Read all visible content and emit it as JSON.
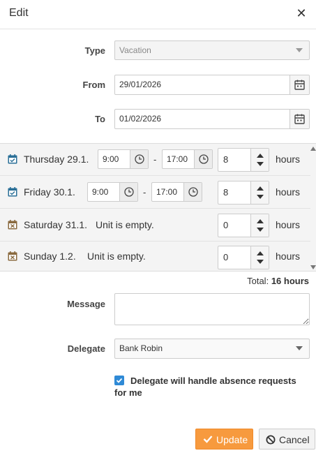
{
  "dialog": {
    "title": "Edit"
  },
  "form": {
    "type": {
      "label": "Type",
      "value": "Vacation"
    },
    "from": {
      "label": "From",
      "value": "29/01/2026"
    },
    "to": {
      "label": "To",
      "value": "01/02/2026"
    },
    "days": [
      {
        "name": "Thursday 29.1.",
        "start": "9:00",
        "end": "17:00",
        "hours": "8",
        "unit": "hours",
        "icon": "calendar-check-icon"
      },
      {
        "name": "Friday 30.1.",
        "start": "9:00",
        "end": "17:00",
        "hours": "8",
        "unit": "hours",
        "icon": "calendar-check-icon"
      },
      {
        "name": "Saturday 31.1.",
        "empty": "Unit is empty.",
        "hours": "0",
        "unit": "hours",
        "icon": "calendar-x-icon"
      },
      {
        "name": "Sunday 1.2.",
        "empty": "Unit is empty.",
        "hours": "0",
        "unit": "hours",
        "icon": "calendar-x-icon"
      }
    ],
    "time_separator": "-",
    "total": {
      "label": "Total:",
      "value": "16 hours"
    },
    "message": {
      "label": "Message",
      "value": ""
    },
    "delegate": {
      "label": "Delegate",
      "value": "Bank Robin"
    },
    "delegate_checkbox": {
      "label": "Delegate will handle absence requests for me",
      "checked": true
    }
  },
  "buttons": {
    "update": "Update",
    "cancel": "Cancel"
  },
  "colors": {
    "accent": "#f79a3e",
    "checkbox": "#2f8ad6",
    "workday_icon": "#2a6f97",
    "weekend_icon": "#8a6a3f"
  }
}
